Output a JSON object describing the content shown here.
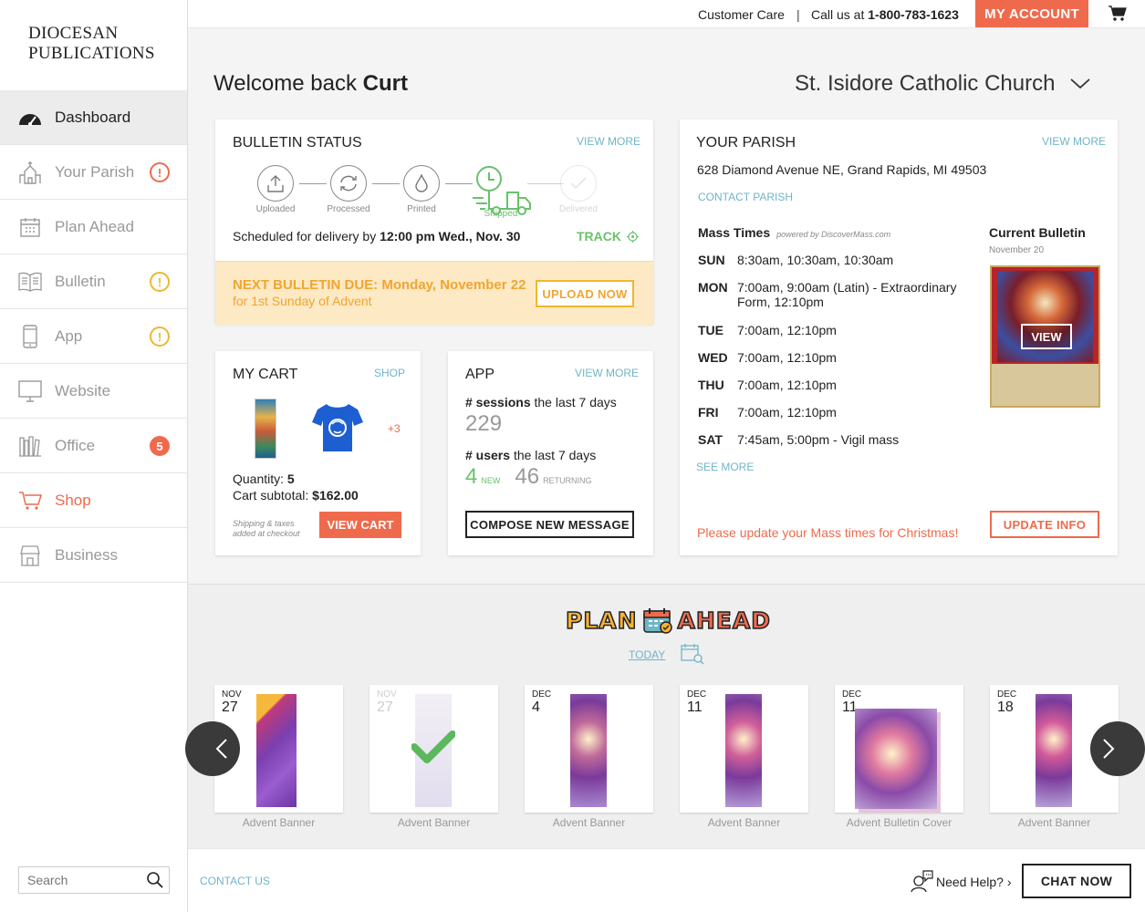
{
  "logo": {
    "line1": "DIOCESAN",
    "line2": "PUBLICATIONS"
  },
  "nav": [
    {
      "label": "Dashboard"
    },
    {
      "label": "Your Parish",
      "badge": "!"
    },
    {
      "label": "Plan Ahead"
    },
    {
      "label": "Bulletin",
      "badge": "!"
    },
    {
      "label": "App",
      "badge": "!"
    },
    {
      "label": "Website"
    },
    {
      "label": "Office",
      "badge": "5"
    },
    {
      "label": "Shop"
    },
    {
      "label": "Business"
    }
  ],
  "search": {
    "placeholder": "Search"
  },
  "topbar": {
    "customer_care": "Customer Care",
    "separator": "|",
    "call_prefix": "Call us at",
    "phone": "1-800-783-1623",
    "my_account": "MY ACCOUNT"
  },
  "welcome": {
    "prefix": "Welcome back",
    "name": "Curt"
  },
  "parish_selector": "St. Isidore Catholic Church",
  "bulletin": {
    "title": "BULLETIN STATUS",
    "view_more": "VIEW MORE",
    "steps": [
      "Uploaded",
      "Processed",
      "Printed",
      "Shipped",
      "Delivered"
    ],
    "scheduled_prefix": "Scheduled for delivery by",
    "scheduled_time": "12:00 pm Wed., Nov. 30",
    "track": "TRACK",
    "due_title": "NEXT BULLETIN DUE: Monday, November 22",
    "due_sub": "for 1st Sunday of Advent",
    "upload": "UPLOAD NOW"
  },
  "cart": {
    "title": "MY CART",
    "shop": "SHOP",
    "more": "+3",
    "qty_label": "Quantity:",
    "qty": "5",
    "subtotal_label": "Cart subtotal:",
    "subtotal": "$162.00",
    "note1": "Shipping & taxes",
    "note2": "added at checkout",
    "view_cart": "VIEW CART"
  },
  "app": {
    "title": "APP",
    "view_more": "VIEW MORE",
    "sessions_bold": "# sessions",
    "sessions_rest": "the last 7 days",
    "sessions": "229",
    "users_bold": "# users",
    "users_rest": "the last 7 days",
    "new_count": "4",
    "new_label": "NEW",
    "returning_count": "46",
    "returning_label": "RETURNING",
    "compose": "COMPOSE NEW MESSAGE"
  },
  "parish": {
    "title": "YOUR PARISH",
    "view_more": "VIEW MORE",
    "address": "628 Diamond Avenue NE, Grand Rapids, MI 49503",
    "contact": "CONTACT PARISH",
    "mass_title": "Mass Times",
    "powered": "powered by DiscoverMass.com",
    "mass": [
      {
        "day": "SUN",
        "times": "8:30am, 10:30am, 10:30am"
      },
      {
        "day": "MON",
        "times": "7:00am, 9:00am (Latin) - Extraordinary",
        "times2": "Form, 12:10pm"
      },
      {
        "day": "TUE",
        "times": "7:00am, 12:10pm"
      },
      {
        "day": "WED",
        "times": "7:00am, 12:10pm"
      },
      {
        "day": "THU",
        "times": "7:00am, 12:10pm"
      },
      {
        "day": "FRI",
        "times": "7:00am, 12:10pm"
      },
      {
        "day": "SAT",
        "times": "7:45am, 5:00pm - Vigil mass"
      }
    ],
    "see_more": "SEE MORE",
    "current_bulletin": "Current Bulletin",
    "bulletin_date": "November 20",
    "view": "VIEW",
    "notice": "Please update your Mass times for Christmas!",
    "update": "UPDATE INFO"
  },
  "plan": {
    "title_left": "PLAN",
    "title_right": "AHEAD",
    "today": "TODAY",
    "items": [
      {
        "month": "NOV",
        "day": "27",
        "caption": "Advent Banner"
      },
      {
        "month": "NOV",
        "day": "27",
        "caption": "Advent Banner"
      },
      {
        "month": "DEC",
        "day": "4",
        "caption": "Advent Banner"
      },
      {
        "month": "DEC",
        "day": "11",
        "caption": "Advent Banner"
      },
      {
        "month": "DEC",
        "day": "11",
        "caption": "Advent Bulletin Cover"
      },
      {
        "month": "DEC",
        "day": "18",
        "caption": "Advent Banner"
      }
    ]
  },
  "footer": {
    "contact": "CONTACT US",
    "help": "Need Help? ›",
    "chat": "CHAT NOW"
  },
  "colors": {
    "accent": "#ef6a4c",
    "green": "#69c16b",
    "teal": "#6fb5c8",
    "warning": "#f0b630"
  }
}
